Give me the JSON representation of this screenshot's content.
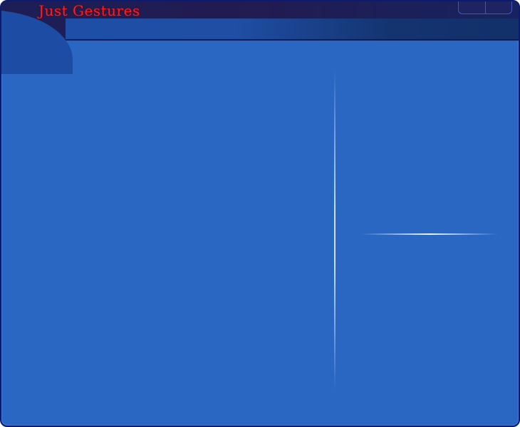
{
  "window": {
    "title": "Just Gestures"
  },
  "colors": {
    "title_text": "#ff1c1c",
    "content_background": "#2967c3",
    "titlebar_dark": "#1c1e55",
    "border": "#0e1a6e"
  },
  "titlebar_buttons": [
    {
      "name": "minimize-button",
      "icon": "minimize-icon"
    },
    {
      "name": "close-button",
      "icon": "close-icon"
    }
  ]
}
